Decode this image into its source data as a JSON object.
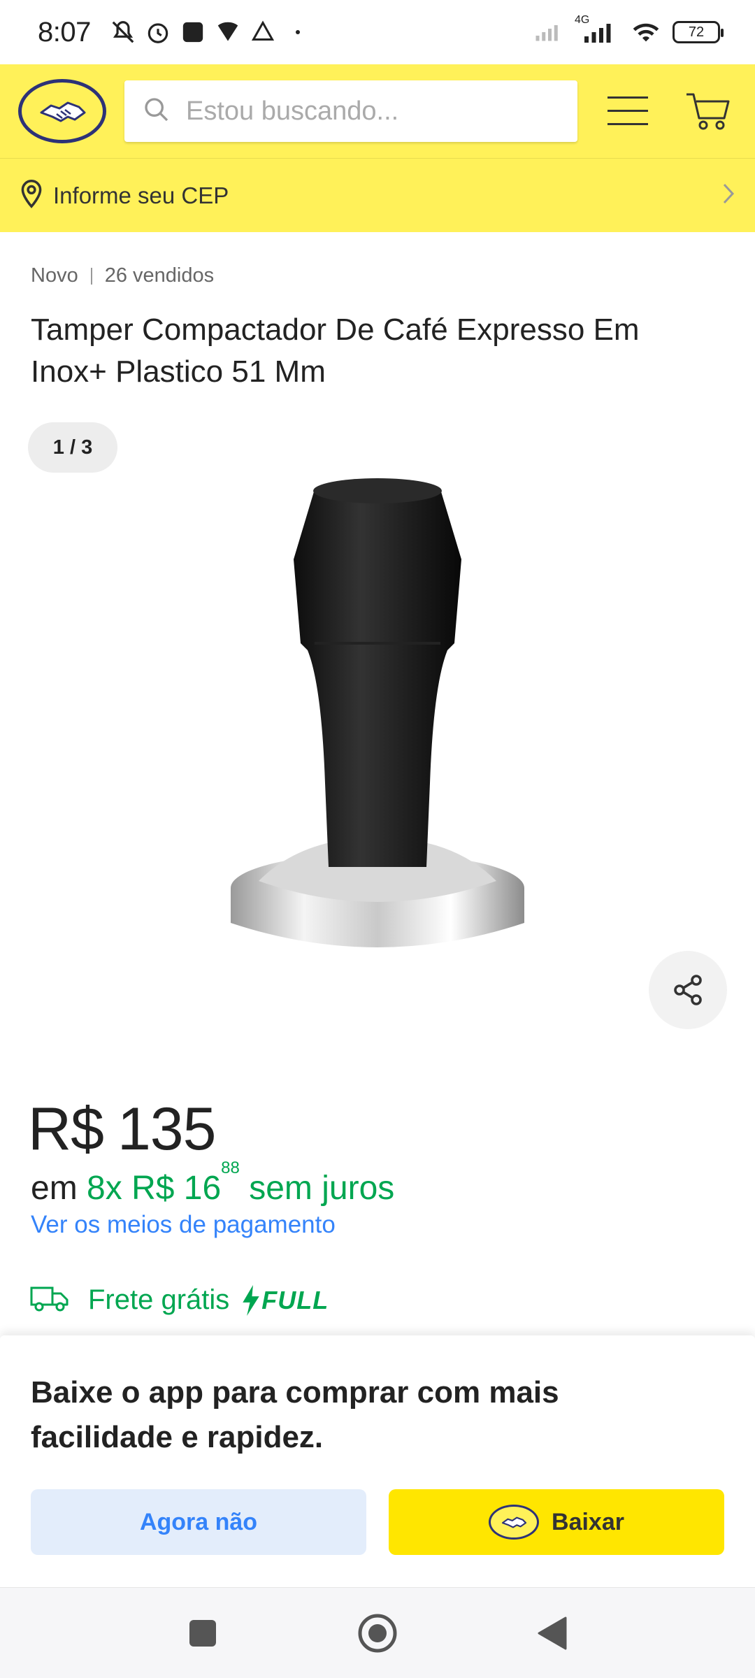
{
  "status_bar": {
    "time": "8:07",
    "network": "4G",
    "battery": "72",
    "left_icons": [
      "mute-icon",
      "alarm-icon",
      "itau-icon",
      "wifi-shield-icon",
      "drive-icon",
      "dot-icon"
    ]
  },
  "header": {
    "search_placeholder": "Estou buscando...",
    "cep_label": "Informe seu CEP"
  },
  "product": {
    "condition": "Novo",
    "sold": "26 vendidos",
    "title": "Tamper Compactador De Café Expresso Em Inox+ Plastico 51 Mm",
    "image_counter": "1 / 3",
    "price_currency": "R$",
    "price_value": "135",
    "installments_prefix": "em",
    "installments_count": "8x R$ 16",
    "installments_cents": "88",
    "installments_suffix": "sem juros",
    "payment_link": "Ver os meios de pagamento",
    "shipping": "Frete grátis",
    "shipping_badge": "FULL"
  },
  "app_banner": {
    "message": "Baixe o app para comprar com mais facilidade e rapidez.",
    "later_label": "Agora não",
    "download_label": "Baixar"
  },
  "colors": {
    "header_yellow": "#fff159",
    "accent_blue": "#3483fa",
    "green": "#00a650",
    "download_yellow": "#ffe600"
  }
}
